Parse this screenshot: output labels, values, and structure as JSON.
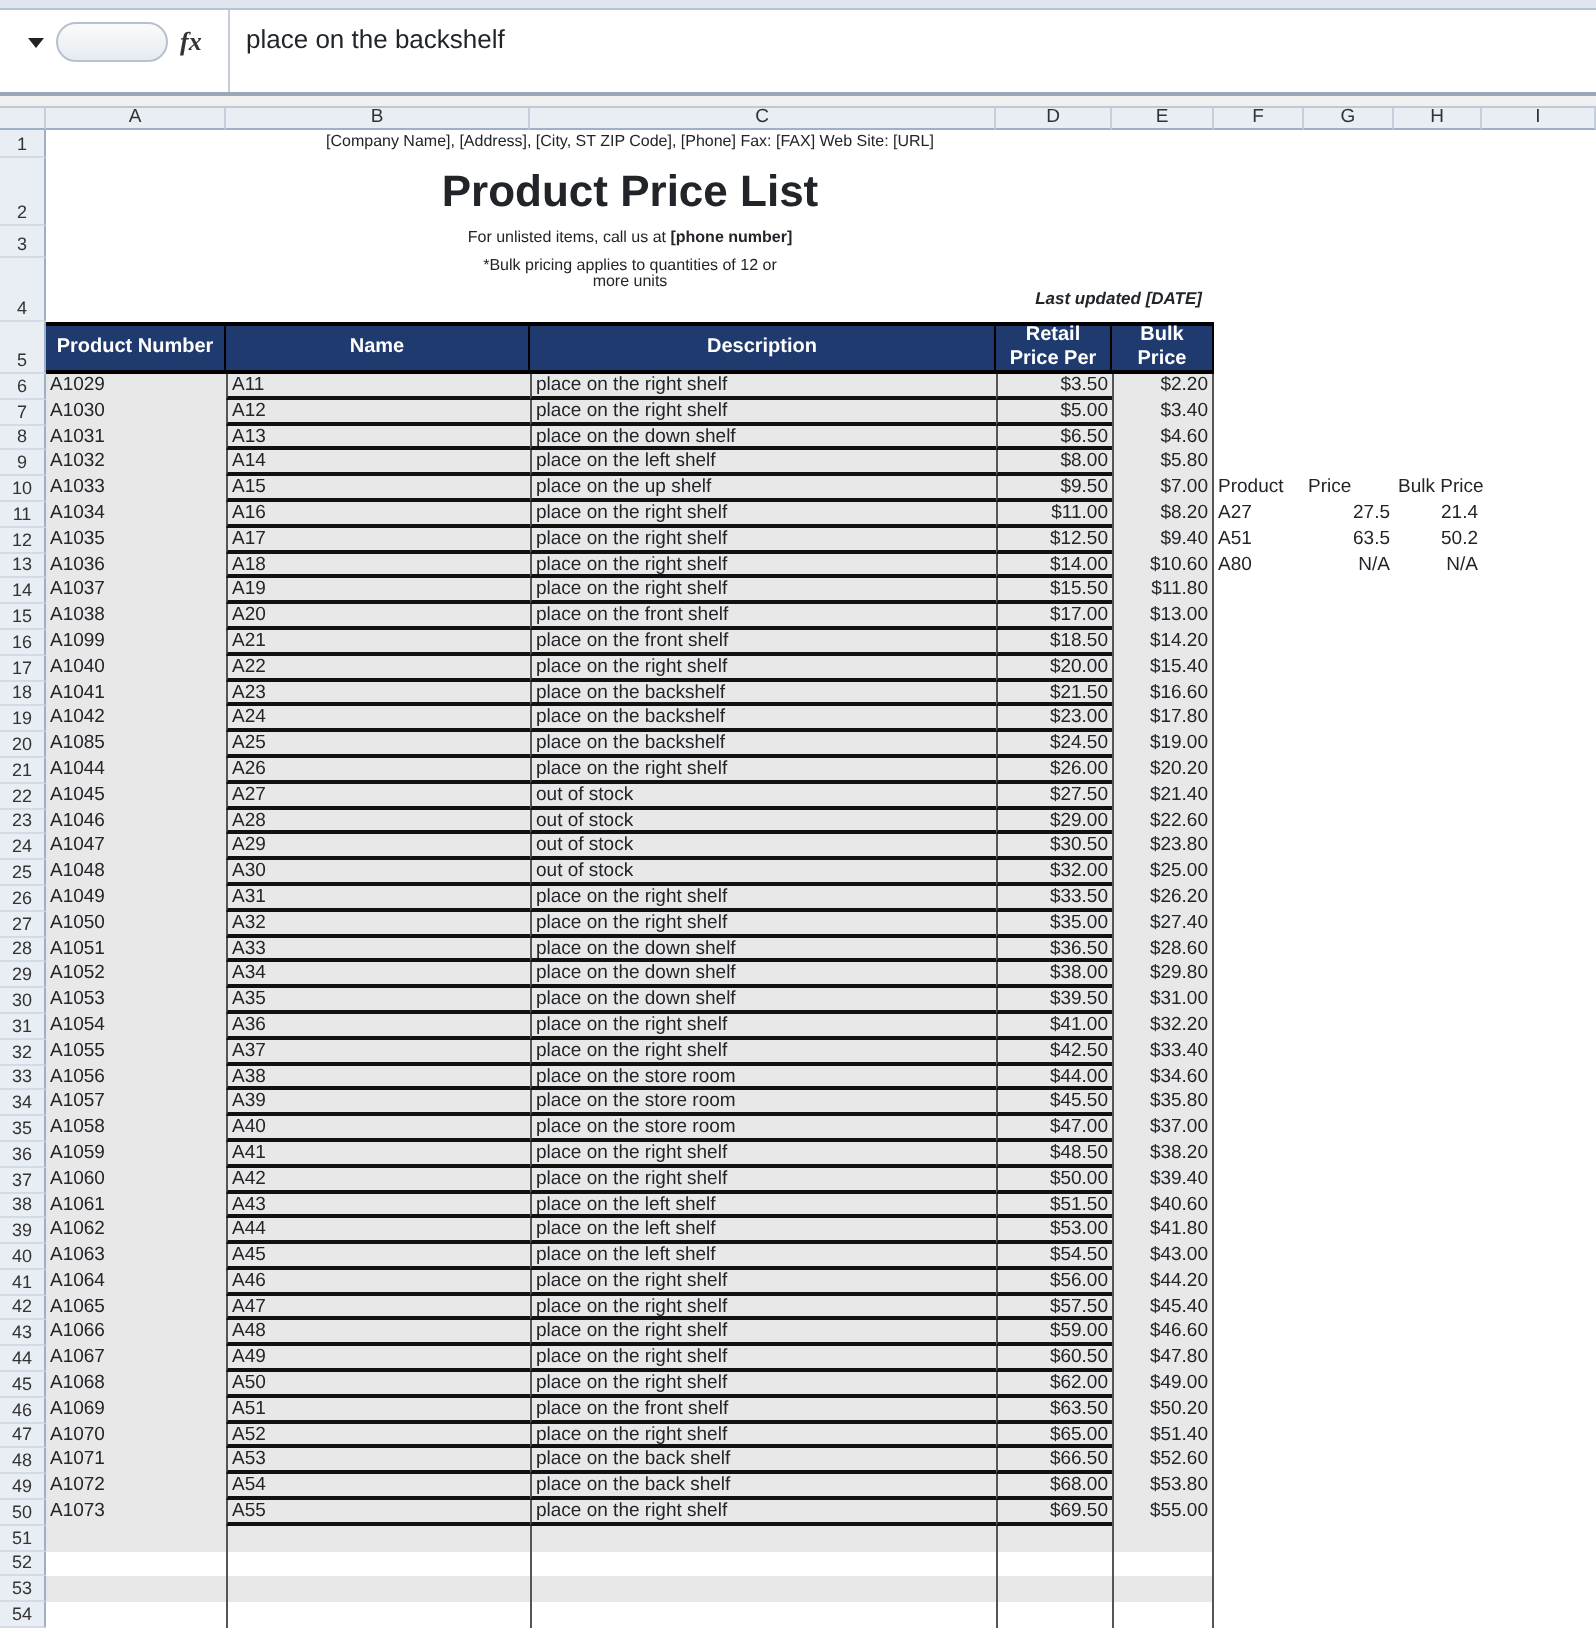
{
  "formula_bar": {
    "function_label": "fx",
    "value": "place on the backshelf"
  },
  "column_headers": [
    "A",
    "B",
    "C",
    "D",
    "E",
    "F",
    "G",
    "H",
    "I"
  ],
  "row_numbers": [
    "1",
    "2",
    "3",
    "4",
    "5",
    "6",
    "7",
    "8",
    "9",
    "10",
    "11",
    "12",
    "13",
    "14",
    "15",
    "16",
    "17",
    "18",
    "19",
    "20",
    "21",
    "22",
    "23",
    "24",
    "25",
    "26",
    "27",
    "28",
    "29",
    "30",
    "31",
    "32",
    "33",
    "34",
    "35",
    "36",
    "37",
    "38",
    "39",
    "40",
    "41",
    "42",
    "43",
    "44",
    "45",
    "46",
    "47",
    "48",
    "49",
    "50",
    "51",
    "52",
    "53",
    "54"
  ],
  "company_line": "[Company Name], [Address], [City, ST  ZIP Code], [Phone] Fax: [FAX] Web Site: [URL]",
  "title": "Product Price List",
  "contact_note": "For unlisted items, call us at **[phone number]**",
  "bulk_note": "*Bulk pricing applies to quantities  of 12 or more units",
  "last_updated": "Last updated [DATE]",
  "table": {
    "columns": [
      "Product Number",
      "Name",
      "Description",
      "Retail Price Per",
      "Bulk Price"
    ],
    "rows": [
      [
        "A1029",
        "A11",
        "place on the right shelf",
        "$3.50",
        "$2.20"
      ],
      [
        "A1030",
        "A12",
        "place on the right shelf",
        "$5.00",
        "$3.40"
      ],
      [
        "A1031",
        "A13",
        "place on the down shelf",
        "$6.50",
        "$4.60"
      ],
      [
        "A1032",
        "A14",
        "place on the left shelf",
        "$8.00",
        "$5.80"
      ],
      [
        "A1033",
        "A15",
        "place on the up shelf",
        "$9.50",
        "$7.00"
      ],
      [
        "A1034",
        "A16",
        "place on the right shelf",
        "$11.00",
        "$8.20"
      ],
      [
        "A1035",
        "A17",
        "place on the right shelf",
        "$12.50",
        "$9.40"
      ],
      [
        "A1036",
        "A18",
        "place on the right shelf",
        "$14.00",
        "$10.60"
      ],
      [
        "A1037",
        "A19",
        "place on the right shelf",
        "$15.50",
        "$11.80"
      ],
      [
        "A1038",
        "A20",
        "place on the front shelf",
        "$17.00",
        "$13.00"
      ],
      [
        "A1099",
        "A21",
        "place on the front shelf",
        "$18.50",
        "$14.20"
      ],
      [
        "A1040",
        "A22",
        "place on the right shelf",
        "$20.00",
        "$15.40"
      ],
      [
        "A1041",
        "A23",
        "place on the backshelf",
        "$21.50",
        "$16.60"
      ],
      [
        "A1042",
        "A24",
        "place on the backshelf",
        "$23.00",
        "$17.80"
      ],
      [
        "A1085",
        "A25",
        "place on the backshelf",
        "$24.50",
        "$19.00"
      ],
      [
        "A1044",
        "A26",
        "place on the right shelf",
        "$26.00",
        "$20.20"
      ],
      [
        "A1045",
        "A27",
        "out of stock",
        "$27.50",
        "$21.40"
      ],
      [
        "A1046",
        "A28",
        "out of stock",
        "$29.00",
        "$22.60"
      ],
      [
        "A1047",
        "A29",
        "out of stock",
        "$30.50",
        "$23.80"
      ],
      [
        "A1048",
        "A30",
        "out of stock",
        "$32.00",
        "$25.00"
      ],
      [
        "A1049",
        "A31",
        "place on the right shelf",
        "$33.50",
        "$26.20"
      ],
      [
        "A1050",
        "A32",
        "place on the right shelf",
        "$35.00",
        "$27.40"
      ],
      [
        "A1051",
        "A33",
        "place on the down shelf",
        "$36.50",
        "$28.60"
      ],
      [
        "A1052",
        "A34",
        "place on the down shelf",
        "$38.00",
        "$29.80"
      ],
      [
        "A1053",
        "A35",
        "place on the down shelf",
        "$39.50",
        "$31.00"
      ],
      [
        "A1054",
        "A36",
        "place on the right shelf",
        "$41.00",
        "$32.20"
      ],
      [
        "A1055",
        "A37",
        "place on the right shelf",
        "$42.50",
        "$33.40"
      ],
      [
        "A1056",
        "A38",
        "place on the store room",
        "$44.00",
        "$34.60"
      ],
      [
        "A1057",
        "A39",
        "place on the store room",
        "$45.50",
        "$35.80"
      ],
      [
        "A1058",
        "A40",
        "place on the store room",
        "$47.00",
        "$37.00"
      ],
      [
        "A1059",
        "A41",
        "place on the right shelf",
        "$48.50",
        "$38.20"
      ],
      [
        "A1060",
        "A42",
        "place on the right shelf",
        "$50.00",
        "$39.40"
      ],
      [
        "A1061",
        "A43",
        "place on the left shelf",
        "$51.50",
        "$40.60"
      ],
      [
        "A1062",
        "A44",
        "place on the left shelf",
        "$53.00",
        "$41.80"
      ],
      [
        "A1063",
        "A45",
        "place on the left shelf",
        "$54.50",
        "$43.00"
      ],
      [
        "A1064",
        "A46",
        "place on the right shelf",
        "$56.00",
        "$44.20"
      ],
      [
        "A1065",
        "A47",
        "place on the right shelf",
        "$57.50",
        "$45.40"
      ],
      [
        "A1066",
        "A48",
        "place on the right shelf",
        "$59.00",
        "$46.60"
      ],
      [
        "A1067",
        "A49",
        "place on the right shelf",
        "$60.50",
        "$47.80"
      ],
      [
        "A1068",
        "A50",
        "place on the right shelf",
        "$62.00",
        "$49.00"
      ],
      [
        "A1069",
        "A51",
        "place on the front shelf",
        "$63.50",
        "$50.20"
      ],
      [
        "A1070",
        "A52",
        "place on the right shelf",
        "$65.00",
        "$51.40"
      ],
      [
        "A1071",
        "A53",
        "place on the back shelf",
        "$66.50",
        "$52.60"
      ],
      [
        "A1072",
        "A54",
        "place on the back shelf",
        "$68.00",
        "$53.80"
      ],
      [
        "A1073",
        "A55",
        "place on the right shelf",
        "$69.50",
        "$55.00"
      ]
    ]
  },
  "lookup": {
    "columns": [
      "Product",
      "Price",
      "Bulk Price"
    ],
    "rows": [
      [
        "A27",
        "27.5",
        "21.4"
      ],
      [
        "A51",
        "63.5",
        "50.2"
      ],
      [
        "A80",
        "N/A",
        "N/A"
      ]
    ]
  }
}
